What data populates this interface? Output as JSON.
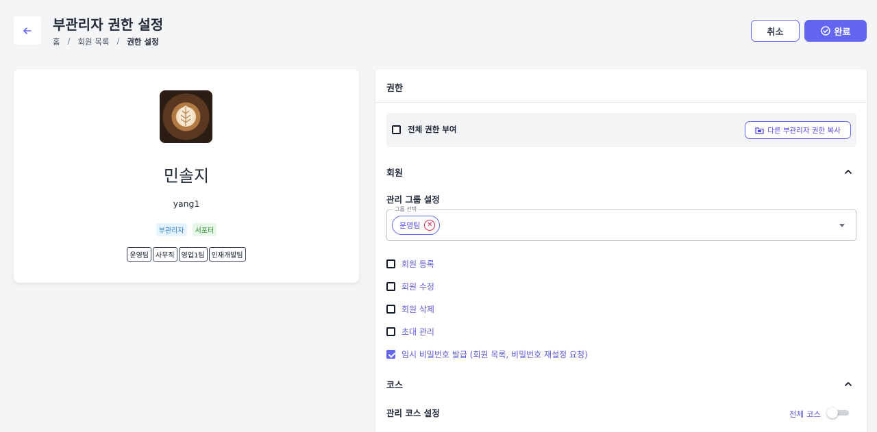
{
  "header": {
    "title": "부관리자 권한 설정",
    "breadcrumb": [
      "홈",
      "회원 목록",
      "권한 설정"
    ],
    "cancel_label": "취소",
    "done_label": "완료"
  },
  "profile": {
    "name": "민솔지",
    "user_id": "yang1",
    "roles": [
      "부관리자",
      "서포터"
    ],
    "teams": [
      "운영팀",
      "사무직",
      "영업1팀",
      "인재개발팀"
    ]
  },
  "permissions": {
    "title": "권한",
    "grant_all_label": "전체 권한 부여",
    "grant_all_checked": false,
    "copy_button_label": "다른 부관리자 권한 복사",
    "member_section": {
      "title": "회원",
      "group_setting_title": "관리 그룹 설정",
      "group_select_legend": "그룹 선택",
      "selected_groups": [
        "운영팀"
      ],
      "items": [
        {
          "label": "회원 등록",
          "checked": false
        },
        {
          "label": "회원 수정",
          "checked": false
        },
        {
          "label": "회원 삭제",
          "checked": false
        },
        {
          "label": "초대 관리",
          "checked": false
        },
        {
          "label": "임시 비밀번호 발급 (회원 목록, 비밀번호 재설정 요청)",
          "checked": true
        }
      ]
    },
    "course_section": {
      "title": "코스",
      "course_setting_title": "관리 코스 설정",
      "all_courses_label": "전체 코스",
      "all_courses_on": false
    }
  },
  "colors": {
    "accent": "#6366f1",
    "background": "#f4f5f7",
    "remove_chip": "#e11d48"
  }
}
